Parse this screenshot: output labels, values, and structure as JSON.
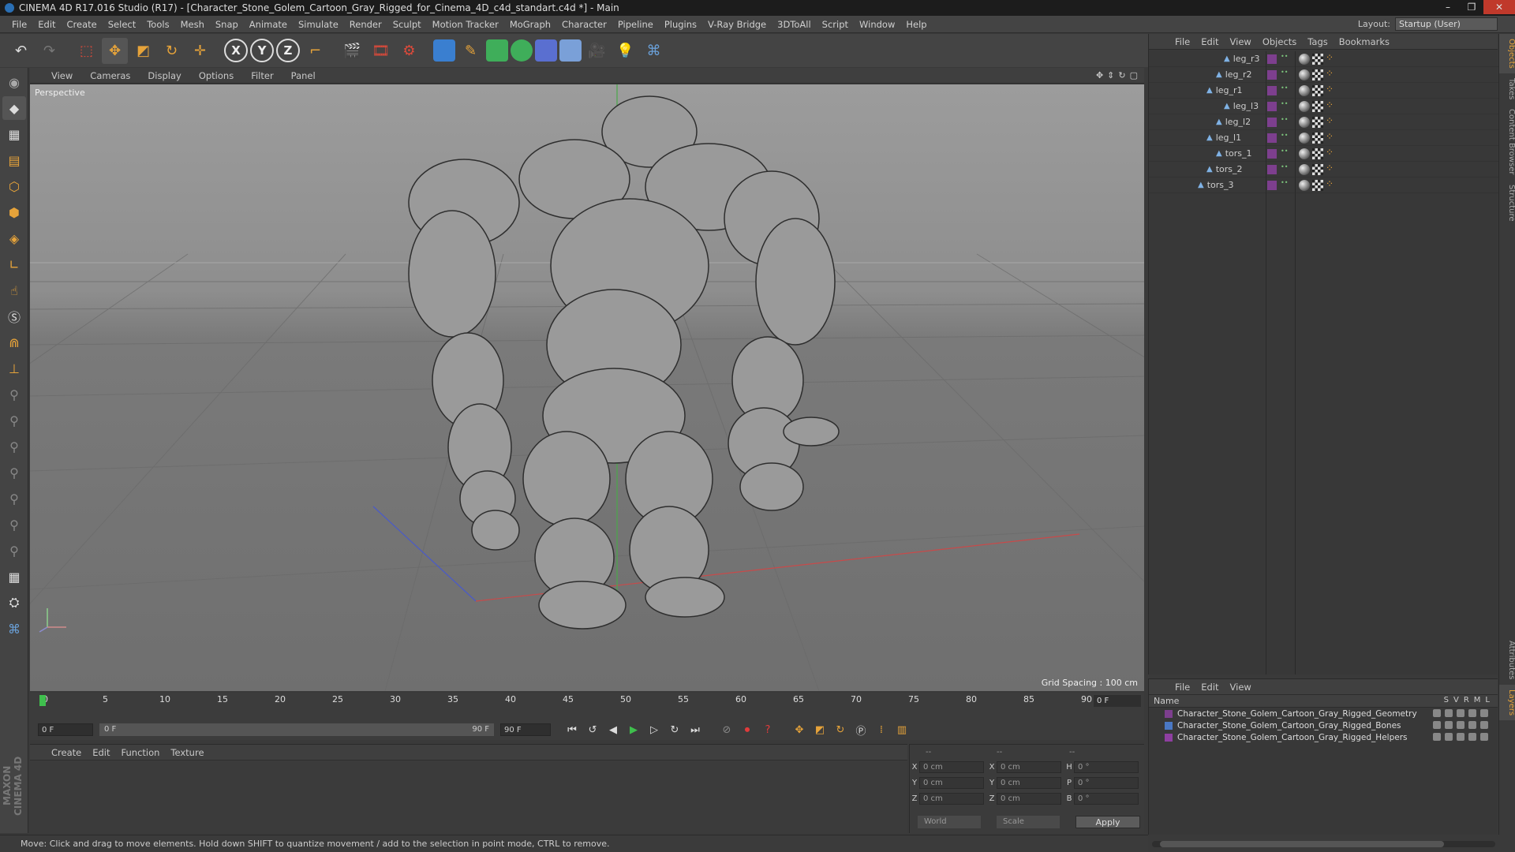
{
  "window": {
    "title": "CINEMA 4D R17.016 Studio (R17) - [Character_Stone_Golem_Cartoon_Gray_Rigged_for_Cinema_4D_c4d_standart.c4d *] - Main",
    "min": "–",
    "max": "❐",
    "close": "✕"
  },
  "menubar": {
    "items": [
      "File",
      "Edit",
      "Create",
      "Select",
      "Tools",
      "Mesh",
      "Snap",
      "Animate",
      "Simulate",
      "Render",
      "Sculpt",
      "Motion Tracker",
      "MoGraph",
      "Character",
      "Pipeline",
      "Plugins",
      "V-Ray Bridge",
      "3DToAll",
      "Script",
      "Window",
      "Help"
    ],
    "layout_label": "Layout:",
    "layout_value": "Startup (User)"
  },
  "toolbar": {
    "axis_x": "X",
    "axis_y": "Y",
    "axis_z": "Z"
  },
  "viewport": {
    "menu": [
      "View",
      "Cameras",
      "Display",
      "Options",
      "Filter",
      "Panel"
    ],
    "label": "Perspective",
    "grid_spacing": "Grid Spacing : 100 cm"
  },
  "timeline": {
    "ticks": [
      "0",
      "5",
      "10",
      "15",
      "20",
      "25",
      "30",
      "35",
      "40",
      "45",
      "50",
      "55",
      "60",
      "65",
      "70",
      "75",
      "80",
      "85",
      "90"
    ],
    "current_frame_right": "0 F",
    "start_field": "0 F",
    "slider_start": "0 F",
    "slider_end": "90 F",
    "end_field": "90 F"
  },
  "materials": {
    "menu": [
      "Create",
      "Edit",
      "Function",
      "Texture"
    ]
  },
  "coordinates": {
    "header_a": "--",
    "header_b": "--",
    "header_c": "--",
    "rows": [
      {
        "axis1": "X",
        "v1": "0 cm",
        "axis2": "X",
        "v2": "0 cm",
        "axis3": "H",
        "v3": "0 °"
      },
      {
        "axis1": "Y",
        "v1": "0 cm",
        "axis2": "Y",
        "v2": "0 cm",
        "axis3": "P",
        "v3": "0 °"
      },
      {
        "axis1": "Z",
        "v1": "0 cm",
        "axis2": "Z",
        "v2": "0 cm",
        "axis3": "B",
        "v3": "0 °"
      }
    ],
    "world": "World",
    "scale": "Scale",
    "apply": "Apply"
  },
  "status": {
    "text": "Move: Click and drag to move elements. Hold down SHIFT to quantize movement / add to the selection in point mode, CTRL to remove."
  },
  "objects": {
    "menu": [
      "File",
      "Edit",
      "View",
      "Objects",
      "Tags",
      "Bookmarks"
    ],
    "items": [
      {
        "name": "leg_r3",
        "depth": 4
      },
      {
        "name": "leg_r2",
        "depth": 3
      },
      {
        "name": "leg_r1",
        "depth": 2
      },
      {
        "name": "leg_l3",
        "depth": 4
      },
      {
        "name": "leg_l2",
        "depth": 3
      },
      {
        "name": "leg_l1",
        "depth": 2
      },
      {
        "name": "tors_1",
        "depth": 3
      },
      {
        "name": "tors_2",
        "depth": 2
      },
      {
        "name": "tors_3",
        "depth": 1
      }
    ]
  },
  "layers": {
    "menu": [
      "File",
      "Edit",
      "View"
    ],
    "name_col": "Name",
    "cols": [
      "S",
      "V",
      "R",
      "M",
      "L"
    ],
    "items": [
      {
        "name": "Character_Stone_Golem_Cartoon_Gray_Rigged_Geometry",
        "color": "#7d3f8e"
      },
      {
        "name": "Character_Stone_Golem_Cartoon_Gray_Rigged_Bones",
        "color": "#4a78c4"
      },
      {
        "name": "Character_Stone_Golem_Cartoon_Gray_Rigged_Helpers",
        "color": "#8e3fa0"
      }
    ]
  },
  "side_tabs": [
    "Objects",
    "Takes",
    "Content Browser",
    "Structure",
    "Attributes",
    "Layers"
  ],
  "brand": "MAXON CINEMA 4D"
}
